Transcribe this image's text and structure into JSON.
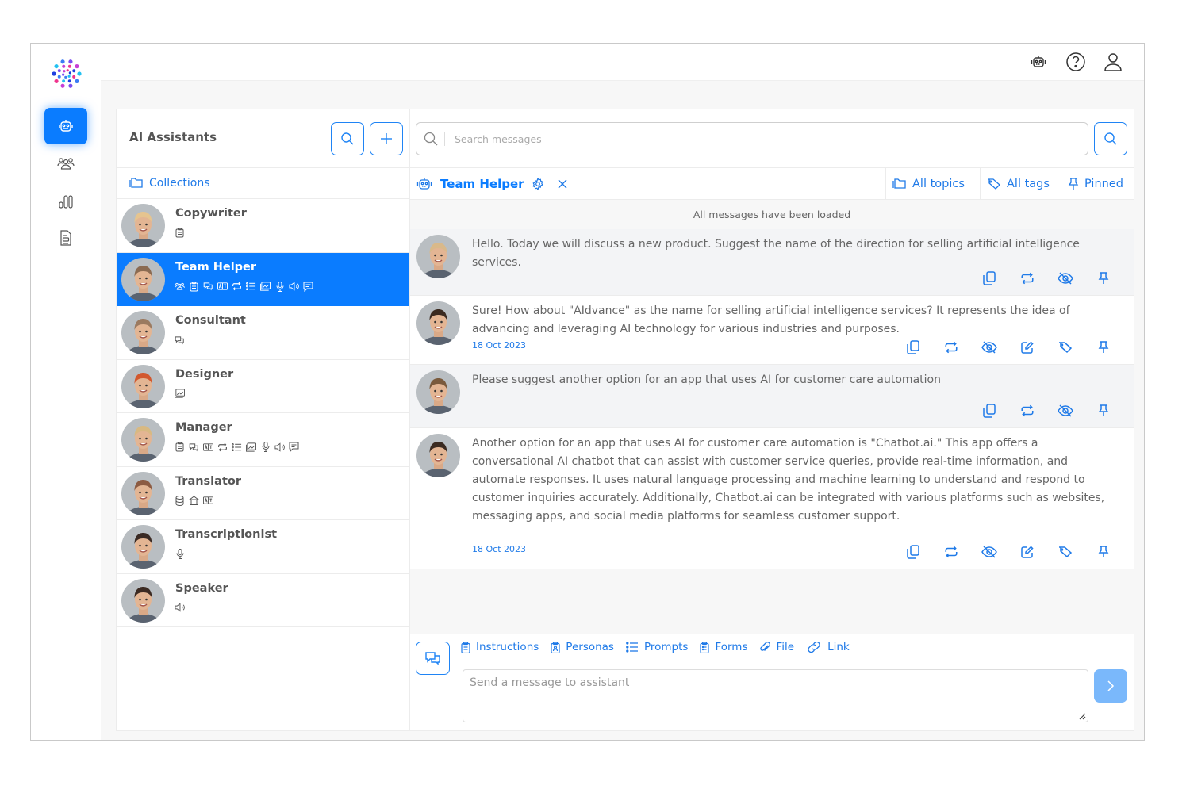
{
  "topbar": {
    "icons": [
      "robot-icon",
      "help-icon",
      "user-icon"
    ]
  },
  "nav": {
    "items": [
      {
        "name": "assistants",
        "icon": "robot-icon",
        "active": true
      },
      {
        "name": "teams",
        "icon": "users-icon",
        "active": false
      },
      {
        "name": "analytics",
        "icon": "bar-chart-icon",
        "active": false
      },
      {
        "name": "documents",
        "icon": "document-icon",
        "active": false
      }
    ]
  },
  "assistants_panel": {
    "title": "AI Assistants",
    "collections_label": "Collections",
    "items": [
      {
        "name": "Copywriter",
        "capabilities": [
          "instructions"
        ],
        "active": false,
        "avatar_color": "#e6c48f"
      },
      {
        "name": "Team Helper",
        "capabilities": [
          "team",
          "instructions",
          "chat",
          "translate",
          "repeat",
          "list",
          "image",
          "mic",
          "speaker",
          "comment"
        ],
        "active": true,
        "avatar_color": "#8b6b52"
      },
      {
        "name": "Consultant",
        "capabilities": [
          "chat"
        ],
        "active": false,
        "avatar_color": "#9b7a60"
      },
      {
        "name": "Designer",
        "capabilities": [
          "image"
        ],
        "active": false,
        "avatar_color": "#d2582e"
      },
      {
        "name": "Manager",
        "capabilities": [
          "instructions",
          "chat",
          "translate",
          "repeat",
          "list",
          "image",
          "mic",
          "speaker",
          "comment"
        ],
        "active": false,
        "avatar_color": "#d8b982"
      },
      {
        "name": "Translator",
        "capabilities": [
          "database",
          "museum",
          "translate"
        ],
        "active": false,
        "avatar_color": "#8c5b42"
      },
      {
        "name": "Transcriptionist",
        "capabilities": [
          "mic"
        ],
        "active": false,
        "avatar_color": "#3a2a24"
      },
      {
        "name": "Speaker",
        "capabilities": [
          "speaker"
        ],
        "active": false,
        "avatar_color": "#3b2a22"
      }
    ]
  },
  "chat": {
    "search_placeholder": "Search messages",
    "assistant_title": "Team Helper",
    "filters": {
      "topics": "All topics",
      "tags": "All tags",
      "pinned": "Pinned"
    },
    "loaded_notice": "All messages have been loaded",
    "messages": [
      {
        "role": "user",
        "text": "Hello. Today we will discuss a new product. Suggest the name of the direction for selling artificial intelligence services.",
        "date": "",
        "actions": [
          "copy",
          "repeat",
          "hide",
          "pin"
        ]
      },
      {
        "role": "assistant",
        "text": "Sure! How about \"AIdvance\" as the name for selling artificial intelligence services? It represents the idea of advancing and leveraging AI technology for various industries and purposes.",
        "date": "18 Oct 2023",
        "actions": [
          "copy",
          "repeat",
          "hide",
          "edit",
          "tag",
          "pin"
        ]
      },
      {
        "role": "user",
        "text": "Please suggest another option for an app that uses AI for customer care automation",
        "date": "",
        "actions": [
          "copy",
          "repeat",
          "hide",
          "pin"
        ]
      },
      {
        "role": "assistant",
        "text": "Another option for an app that uses AI for customer care automation is \"Chatbot.ai.\" This app offers a conversational AI chatbot that can assist with customer service queries, provide real-time information, and automate responses. It uses natural language processing and machine learning to understand and respond to customer inquiries accurately. Additionally, Chatbot.ai can be integrated with various platforms such as websites, messaging apps, and social media platforms for seamless customer support.",
        "date": "18 Oct 2023",
        "actions": [
          "copy",
          "repeat",
          "hide",
          "edit",
          "tag",
          "pin"
        ]
      }
    ],
    "composer": {
      "tools": [
        {
          "label": "Instructions",
          "icon": "clipboard-icon"
        },
        {
          "label": "Personas",
          "icon": "badge-icon"
        },
        {
          "label": "Prompts",
          "icon": "list-icon"
        },
        {
          "label": "Forms",
          "icon": "form-icon"
        },
        {
          "label": "File",
          "icon": "paperclip-icon"
        },
        {
          "label": "Link",
          "icon": "link-icon"
        }
      ],
      "placeholder": "Send a message to assistant"
    }
  },
  "colors": {
    "accent": "#0a7cff",
    "link": "#1f7ae8",
    "send_disabled": "#7ab8fb"
  }
}
